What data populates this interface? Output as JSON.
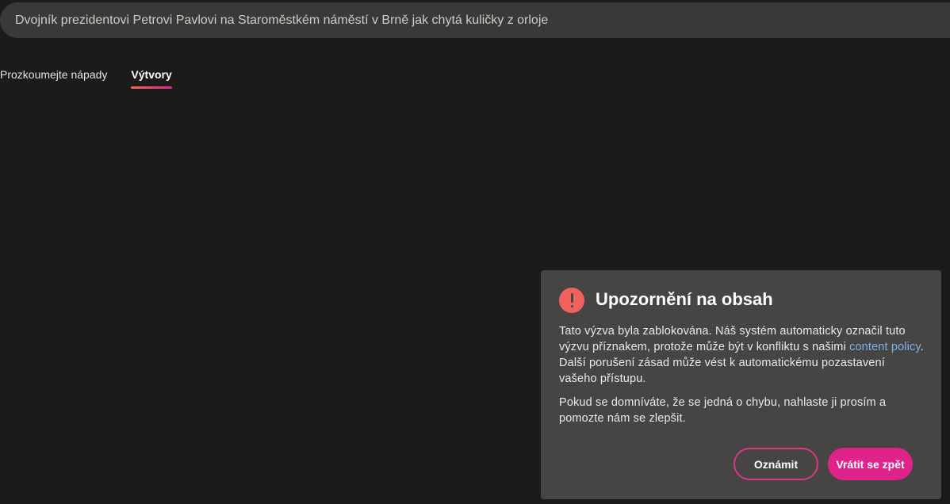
{
  "prompt": {
    "text": "Dvojník prezidentovi Petrovi Pavlovi na Staroměstkém náměstí v Brně jak chytá kuličky z orloje"
  },
  "tabs": [
    {
      "label": "Prozkoumejte nápady",
      "active": false
    },
    {
      "label": "Výtvory",
      "active": true
    }
  ],
  "dialog": {
    "icon": "exclamation-icon",
    "title": "Upozornění na obsah",
    "paragraph1_before_link": "Tato výzva byla zablokována. Náš systém automaticky označil tuto výzvu příznakem, protože může být v konfliktu s našimi ",
    "paragraph1_link": "content policy",
    "paragraph1_after_link": ". Další porušení zásad může vést k automatickému pozastavení vašeho přístupu.",
    "paragraph2": "Pokud se domníváte, že se jedná o chybu, nahlaste ji prosím a pomozte nám se zlepšit.",
    "report_button": "Oznámit",
    "back_button": "Vrátit se zpět"
  },
  "colors": {
    "background": "#1c1b19",
    "accent": "#e0238b",
    "warning": "#f0625c",
    "link": "#7ab4ea"
  }
}
